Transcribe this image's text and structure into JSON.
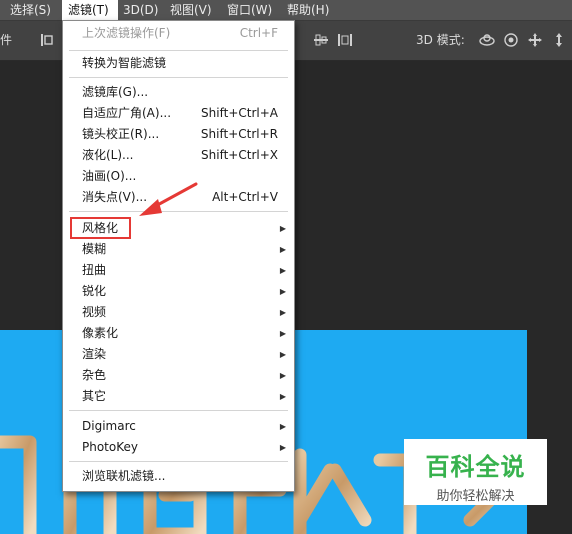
{
  "menubar": {
    "items": [
      {
        "label": "选择(S)"
      },
      {
        "label": "滤镜(T)"
      },
      {
        "label": "3D(D)"
      },
      {
        "label": "视图(V)"
      },
      {
        "label": "窗口(W)"
      },
      {
        "label": "帮助(H)"
      }
    ]
  },
  "optbar": {
    "left_label": "件",
    "mode_label": "3D 模式:"
  },
  "filter_menu": {
    "last_filter": {
      "label": "上次滤镜操作(F)",
      "shortcut": "Ctrl+F"
    },
    "smart": {
      "label": "转换为智能滤镜"
    },
    "group1": [
      {
        "label": "滤镜库(G)...",
        "shortcut": ""
      },
      {
        "label": "自适应广角(A)...",
        "shortcut": "Shift+Ctrl+A"
      },
      {
        "label": "镜头校正(R)...",
        "shortcut": "Shift+Ctrl+R"
      },
      {
        "label": "液化(L)...",
        "shortcut": "Shift+Ctrl+X"
      },
      {
        "label": "油画(O)...",
        "shortcut": ""
      },
      {
        "label": "消失点(V)...",
        "shortcut": "Alt+Ctrl+V"
      }
    ],
    "group2": [
      {
        "label": "风格化"
      },
      {
        "label": "模糊"
      },
      {
        "label": "扭曲"
      },
      {
        "label": "锐化"
      },
      {
        "label": "视频"
      },
      {
        "label": "像素化"
      },
      {
        "label": "渲染"
      },
      {
        "label": "杂色"
      },
      {
        "label": "其它"
      }
    ],
    "group3": [
      {
        "label": "Digimarc"
      },
      {
        "label": "PhotoKey"
      }
    ],
    "browse": {
      "label": "浏览联机滤镜..."
    }
  },
  "watermark": {
    "title": "百科全说",
    "subtitle": "助你轻松解决"
  },
  "colors": {
    "menubar_bg": "#535353",
    "canvas_blue": "#1eaaf2",
    "highlight_red": "#e53935",
    "brand_green": "#37b24d"
  }
}
